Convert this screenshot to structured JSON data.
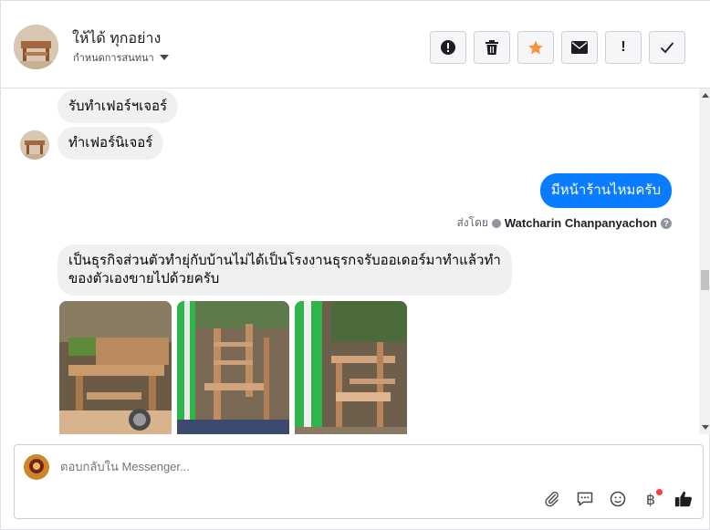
{
  "header": {
    "name": "ให้ได้ ทุกอย่าง",
    "subtitle": "กำหนดการสนทนา"
  },
  "actions": [
    {
      "name": "spam-report-button",
      "icon": "alert-circle-icon"
    },
    {
      "name": "delete-button",
      "icon": "trash-icon"
    },
    {
      "name": "star-button",
      "icon": "star-icon",
      "color": "#f7923b"
    },
    {
      "name": "mark-unread-button",
      "icon": "envelope-icon"
    },
    {
      "name": "important-button",
      "icon": "exclamation-icon",
      "label": "!"
    },
    {
      "name": "done-button",
      "icon": "checkmark-icon"
    }
  ],
  "messages": {
    "m1": "รับทำเฟอร์ฯเจอร์",
    "m2": "ทำเฟอร์นิเจอร์",
    "m3": "มีหน้าร้านไหมครับ",
    "m4": "เป็นธุรกิจส่วนตัวทำยุ่กับบ้านไม่ได้เป็นโรงงานธุรกจรับออเดอร์มาทำแล้วทำของตัวเองขายไปด้วยครับ",
    "sent_by_label": "ส่งโดย",
    "sent_by_name": "Watcharin Chanpanyachon"
  },
  "composer": {
    "placeholder": "ตอบกลับใน Messenger..."
  },
  "tools": [
    "paperclip-icon",
    "chat-bubble-icon",
    "smiley-icon",
    "baht-icon",
    "thumbs-up-icon"
  ],
  "colors": {
    "outgoing_bubble": "#0a7cff",
    "incoming_bubble": "#f0f0f0",
    "star": "#f7923b",
    "like": "#444950"
  }
}
